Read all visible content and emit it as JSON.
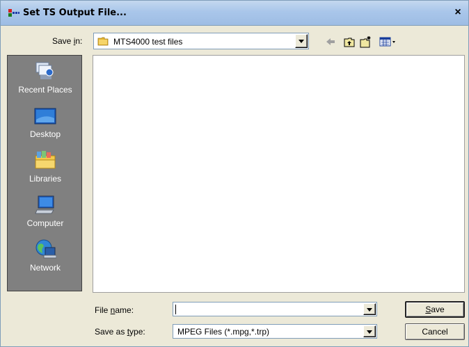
{
  "window": {
    "title": "Set TS Output File...",
    "close_glyph": "×"
  },
  "save_in": {
    "label_pre": "Save ",
    "label_accel": "i",
    "label_post": "n:",
    "value": "MTS4000 test files"
  },
  "toolbar": {
    "icons": [
      "back-arrow-icon",
      "up-folder-icon",
      "new-folder-icon",
      "view-menu-icon"
    ]
  },
  "places": [
    {
      "label": "Recent Places",
      "icon": "recent-places-icon"
    },
    {
      "label": "Desktop",
      "icon": "desktop-icon"
    },
    {
      "label": "Libraries",
      "icon": "libraries-icon"
    },
    {
      "label": "Computer",
      "icon": "computer-icon"
    },
    {
      "label": "Network",
      "icon": "network-icon"
    }
  ],
  "file_name": {
    "label_pre": "File ",
    "label_accel": "n",
    "label_post": "ame:",
    "value": ""
  },
  "save_as_type": {
    "label_pre": "Save as ",
    "label_accel": "t",
    "label_post": "ype:",
    "value": "MPEG Files (*.mpg,*.trp)"
  },
  "buttons": {
    "save_accel": "S",
    "save_rest": "ave",
    "cancel": "Cancel"
  }
}
